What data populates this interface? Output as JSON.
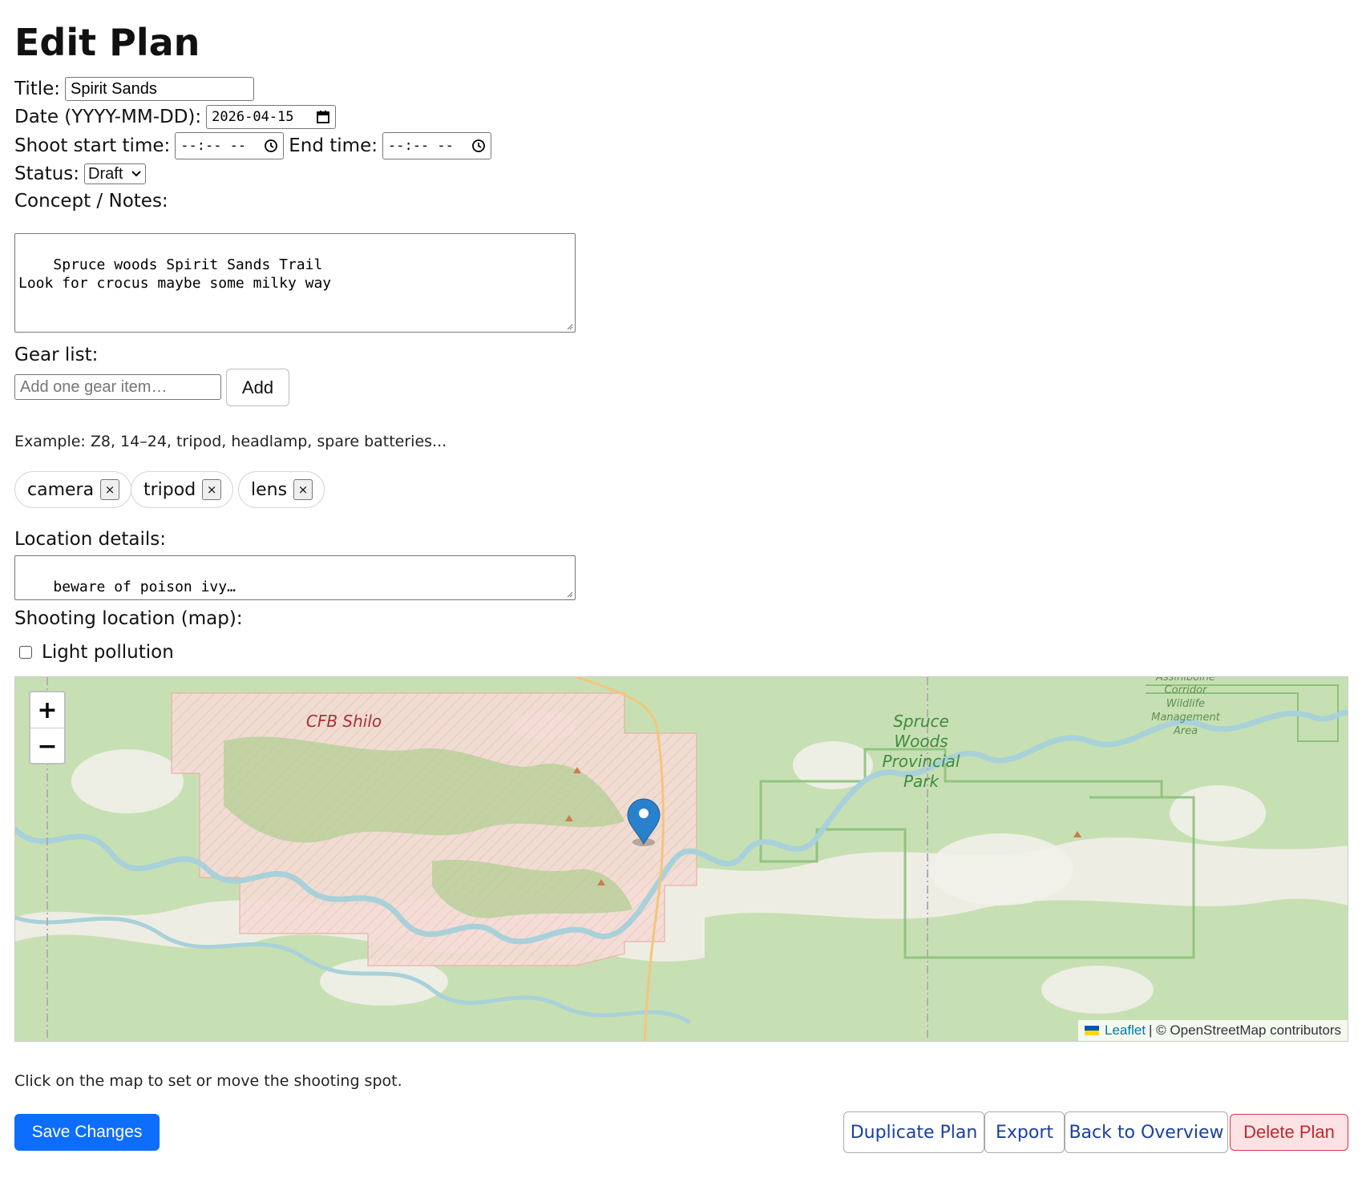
{
  "page": {
    "title": "Edit Plan"
  },
  "form": {
    "title_label": "Title:",
    "title_value": "Spirit Sands",
    "date_label": "Date (YYYY-MM-DD):",
    "date_value": "2026-04-15",
    "start_label": "Shoot start time:",
    "start_value": "--:-- --",
    "end_label": "End time:",
    "end_value": "--:-- --",
    "status_label": "Status:",
    "status_value": "Draft",
    "notes_label": "Concept / Notes:",
    "notes_value": "Spruce woods Spirit Sands Trail\nLook for crocus maybe some milky way",
    "gear_label": "Gear list:",
    "gear_placeholder": "Add one gear item…",
    "gear_add_label": "Add",
    "gear_hint": "Example: Z8, 14–24, tripod, headlamp, spare batteries...",
    "gear_items": [
      "camera",
      "tripod",
      "lens"
    ],
    "chip_remove": "×",
    "location_label": "Location details:",
    "location_value": "beware of poison ivy…",
    "map_label": "Shooting location (map):",
    "light_pollution_label": "Light pollution",
    "light_pollution_checked": false
  },
  "map": {
    "zoom_in": "+",
    "zoom_out": "−",
    "labels": {
      "cfb_shilo": "CFB Shilo",
      "park_1": "Spruce",
      "park_2": "Woods",
      "park_3": "Provincial",
      "park_4": "Park",
      "corridor_1": "Assiniboine",
      "corridor_2": "Corridor",
      "corridor_3": "Wildlife",
      "corridor_4": "Management",
      "corridor_5": "Area"
    },
    "attribution_link": "Leaflet",
    "attribution_text": "| © OpenStreetMap contributors",
    "hint": "Click on the map to set or move the shooting spot."
  },
  "actions": {
    "save": "Save Changes",
    "duplicate": "Duplicate Plan",
    "export": "Export",
    "back": "Back to Overview",
    "delete": "Delete Plan"
  },
  "colors": {
    "primary": "#0d6efd",
    "danger": "#dc3545",
    "map_green": "#c5dfb0",
    "map_military": "#f3d9d3",
    "map_river": "#a9d2dc",
    "marker": "#2a81cb"
  }
}
